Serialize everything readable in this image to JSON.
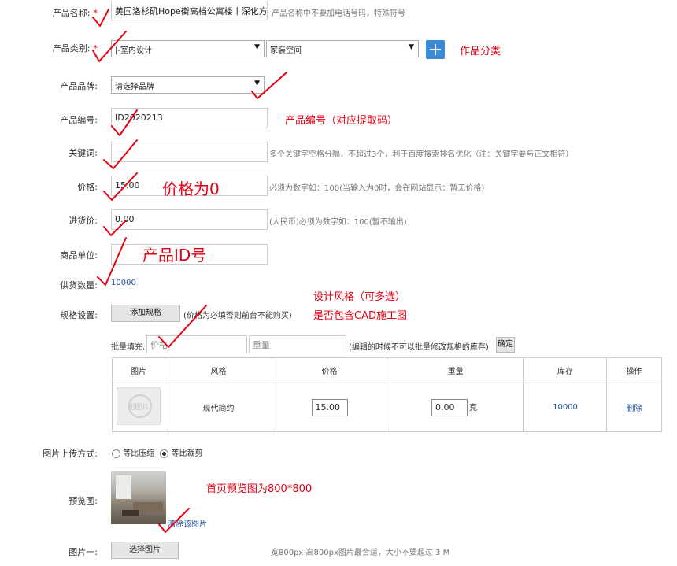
{
  "form": {
    "product_name": {
      "label": "产品名称:",
      "required_mark": "*",
      "value": "美国洛杉矶Hope街高档公寓楼丨深化方案",
      "hint": "产品名称中不要加电话号码，特殊符号"
    },
    "category": {
      "label": "产品类别:",
      "required_mark": "*",
      "select1": "|-室内设计",
      "select2": "家装空间"
    },
    "brand": {
      "label": "产品品牌:",
      "value": "请选择品牌"
    },
    "code": {
      "label": "产品编号:",
      "value": "ID2020213"
    },
    "keywords": {
      "label": "关键词:",
      "value": "",
      "hint": "多个关键字空格分隔，不超过3个，利于百度搜索排名优化（注：关键字要与正文相符）"
    },
    "price": {
      "label": "价格:",
      "value": "15.00",
      "hint": "必须为数字如：100(当输入为0时，会在网站显示：暂无价格)"
    },
    "cost": {
      "label": "进货价:",
      "value": "0.00",
      "hint": "(人民币)必须为数字如：100(暂不输出)"
    },
    "unit": {
      "label": "商品单位:",
      "value": ""
    },
    "supply": {
      "label": "供货数量:",
      "value": "10000"
    },
    "spec": {
      "label": "规格设置:",
      "add_button": "添加规格",
      "hint": "(价格为必填否则前台不能购买)"
    },
    "batch": {
      "label": "批量填充:",
      "price_placeholder": "价格",
      "weight_placeholder": "重量",
      "hint": "(编辑的时候不可以批量修改规格的库存)",
      "confirm": "确定"
    },
    "table": {
      "headers": [
        "图片",
        "风格",
        "价格",
        "重量",
        "库存",
        "操作"
      ],
      "rows": [
        {
          "image_text": "无图片",
          "style": "现代简约",
          "price": "15.00",
          "weight": "0.00",
          "weight_unit": "克",
          "stock": "10000",
          "action": "删除"
        }
      ]
    },
    "upload_mode": {
      "label": "图片上传方式:",
      "option1": "等比压缩",
      "option2": "等比裁剪",
      "selected": "等比裁剪"
    },
    "preview": {
      "label": "预览图:",
      "clear_link": "清除该图片"
    },
    "image1": {
      "label": "图片一:",
      "button": "选择图片",
      "hint": "宽800px 高800px图片最合适，大小不要超过 3 M"
    }
  },
  "annotations": {
    "category_note": "作品分类",
    "code_note": "产品编号（对应提取码）",
    "price_note": "价格为0",
    "unit_note": "产品ID号",
    "spec_note1": "设计风格（可多选）",
    "spec_note2": "是否包含CAD施工图",
    "preview_note": "首页预览图为800*800"
  },
  "colors": {
    "annotation": "#e60012",
    "link": "#1f4e9a",
    "plus_button": "#3b8ad9"
  }
}
